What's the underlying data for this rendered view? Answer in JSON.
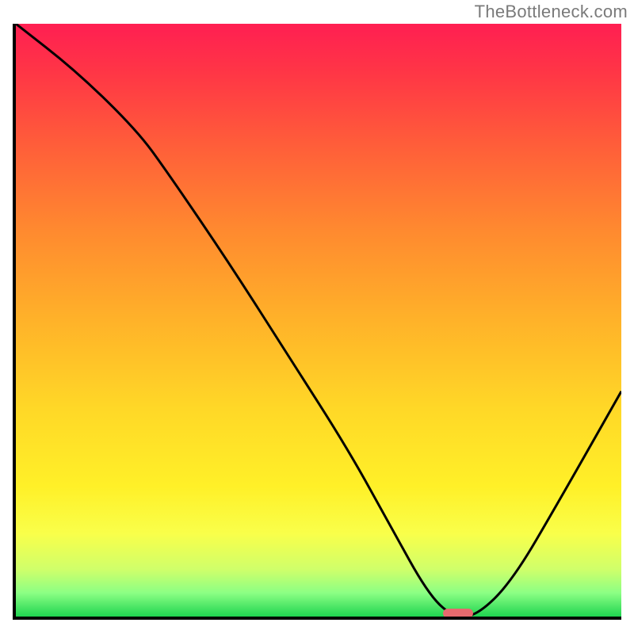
{
  "watermark": "TheBottleneck.com",
  "chart_data": {
    "type": "line",
    "title": "",
    "xlabel": "",
    "ylabel": "",
    "xlim": [
      0,
      100
    ],
    "ylim": [
      0,
      100
    ],
    "gradient_colors": [
      "#ff1f52",
      "#ff3546",
      "#ff5c3a",
      "#ff8a2f",
      "#ffb229",
      "#ffd827",
      "#fff028",
      "#f9ff4a",
      "#d0ff6a",
      "#8cff84",
      "#1fd451"
    ],
    "curve_description": "single black curve descending steeply from top-left, kink near x~25, reaching a flat minimum around x~70-75, then rising toward right edge",
    "x": [
      0,
      10,
      20,
      25,
      35,
      45,
      55,
      62,
      68,
      72,
      76,
      82,
      90,
      100
    ],
    "values": [
      100,
      92,
      82,
      75,
      60,
      44,
      28,
      15,
      4,
      0,
      0,
      6,
      20,
      38
    ],
    "marker": {
      "x_center": 73,
      "y": 0,
      "color": "#e76a6e"
    }
  }
}
